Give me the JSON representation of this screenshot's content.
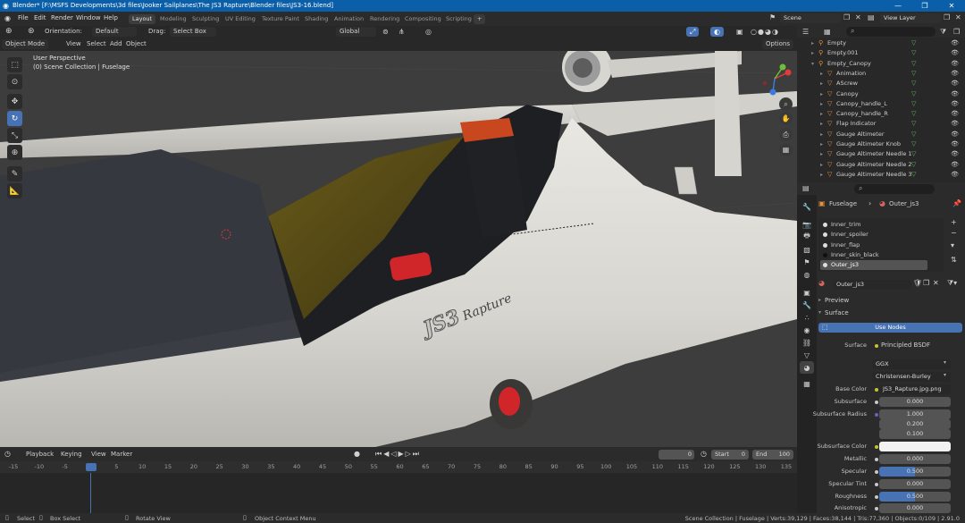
{
  "window": {
    "title": "Blender* [F:\\MSFS Developments\\3d files\\Jooker Sailplanes\\The JS3 Rapture\\Blender files\\JS3-16.blend]",
    "minimize": "—",
    "maximize": "❐",
    "close": "✕"
  },
  "menubar": {
    "items": [
      "File",
      "Edit",
      "Render",
      "Window",
      "Help"
    ],
    "workspaces": [
      "Layout",
      "Modeling",
      "Sculpting",
      "UV Editing",
      "Texture Paint",
      "Shading",
      "Animation",
      "Rendering",
      "Compositing",
      "Scripting"
    ],
    "add_workspace": "+",
    "scene": "Scene",
    "view_layer": "View Layer"
  },
  "viewport_header": {
    "orientation_label": "Orientation:",
    "orientation_value": "Default",
    "drag_label": "Drag:",
    "drag_value": "Select Box",
    "transform": "Global",
    "options": "Options",
    "mode": "Object Mode",
    "menus": [
      "View",
      "Select",
      "Add",
      "Object"
    ]
  },
  "viewport": {
    "perspective": "User Perspective",
    "collection": "(0) Scene Collection | Fuselage",
    "logo_text": "Rapture",
    "logo_mark": "JS3"
  },
  "timeline": {
    "menus": [
      "Playback",
      "Keying",
      "View",
      "Marker"
    ],
    "current_frame": "0",
    "start_label": "Start",
    "start": "0",
    "end_label": "End",
    "end": "100",
    "ticks": [
      "-15",
      "-10",
      "-5",
      "0",
      "5",
      "10",
      "15",
      "20",
      "25",
      "30",
      "35",
      "40",
      "45",
      "50",
      "55",
      "60",
      "65",
      "70",
      "75",
      "80",
      "85",
      "90",
      "95",
      "100",
      "105",
      "110",
      "115",
      "120",
      "125",
      "130",
      "135"
    ]
  },
  "statusbar": {
    "select": "Select",
    "box_select": "Box Select",
    "rotate": "Rotate View",
    "context_menu": "Object Context Menu",
    "stats": "Scene Collection | Fuselage | Verts:39,129 | Faces:38,144 | Tris:77,360 | Objects:0/109 | 2.91.0"
  },
  "outliner": {
    "rows": [
      {
        "label": "Empty",
        "indent": 0,
        "expanded": false
      },
      {
        "label": "Empty.001",
        "indent": 0,
        "expanded": false
      },
      {
        "label": "Empty_Canopy",
        "indent": 0,
        "expanded": true
      },
      {
        "label": "Animation",
        "indent": 1,
        "expanded": false
      },
      {
        "label": "AScrew",
        "indent": 1,
        "expanded": false
      },
      {
        "label": "Canopy",
        "indent": 1,
        "expanded": false
      },
      {
        "label": "Canopy_handle_L",
        "indent": 1,
        "expanded": false
      },
      {
        "label": "Canopy_handle_R",
        "indent": 1,
        "expanded": false
      },
      {
        "label": "Flap Indicator",
        "indent": 1,
        "expanded": false
      },
      {
        "label": "Gauge Altimeter",
        "indent": 1,
        "expanded": false
      },
      {
        "label": "Gauge Altimeter Knob",
        "indent": 1,
        "expanded": false
      },
      {
        "label": "Gauge Altimeter Needle 1",
        "indent": 1,
        "expanded": false
      },
      {
        "label": "Gauge Altimeter Needle 2",
        "indent": 1,
        "expanded": false
      },
      {
        "label": "Gauge Altimeter Needle 3",
        "indent": 1,
        "expanded": false
      }
    ]
  },
  "properties": {
    "object": "Fuselage",
    "material": "Outer_js3",
    "slots": [
      "Inner_trim",
      "Inner_spoiler",
      "Inner_flap",
      "Inner_skin_black",
      "Outer_js3"
    ],
    "material_name": "Outer_js3",
    "preview": "Preview",
    "surface_section": "Surface",
    "use_nodes": "Use Nodes",
    "surface_label": "Surface",
    "surface_value": "Principled BSDF",
    "distribution": "GGX",
    "subsurface_method": "Christensen-Burley",
    "base_color_label": "Base Color",
    "base_color_value": "JS3_Rapture.jpg.png",
    "subsurface_label": "Subsurface",
    "subsurface_value": "0.000",
    "subsurface_radius_label": "Subsurface Radius",
    "subsurface_radius": [
      "1.000",
      "0.200",
      "0.100"
    ],
    "subsurface_color_label": "Subsurface Color",
    "metallic_label": "Metallic",
    "metallic_value": "0.000",
    "specular_label": "Specular",
    "specular_value": "0.500",
    "specular_tint_label": "Specular Tint",
    "specular_tint_value": "0.000",
    "roughness_label": "Roughness",
    "roughness_value": "0.500",
    "anisotropic_label": "Anisotropic",
    "anisotropic_value": "0.000"
  },
  "colors": {
    "accent": "#4772b3",
    "titlebar": "#0a5fa8",
    "object_icon": "#e6903a",
    "modifier_icon": "#5fb85a"
  }
}
